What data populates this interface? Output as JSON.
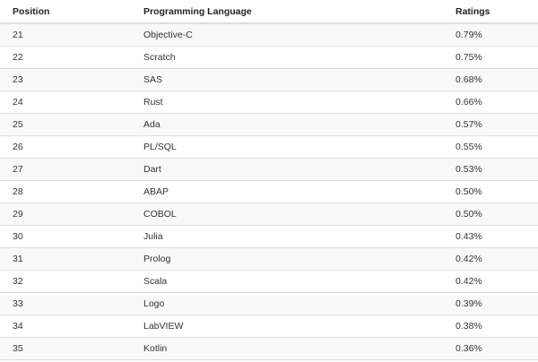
{
  "table": {
    "headers": {
      "position": "Position",
      "language": "Programming Language",
      "ratings": "Ratings"
    },
    "rows": [
      {
        "position": "21",
        "language": "Objective-C",
        "rating": "0.79%"
      },
      {
        "position": "22",
        "language": "Scratch",
        "rating": "0.75%"
      },
      {
        "position": "23",
        "language": "SAS",
        "rating": "0.68%"
      },
      {
        "position": "24",
        "language": "Rust",
        "rating": "0.66%"
      },
      {
        "position": "25",
        "language": "Ada",
        "rating": "0.57%"
      },
      {
        "position": "26",
        "language": "PL/SQL",
        "rating": "0.55%"
      },
      {
        "position": "27",
        "language": "Dart",
        "rating": "0.53%"
      },
      {
        "position": "28",
        "language": "ABAP",
        "rating": "0.50%"
      },
      {
        "position": "29",
        "language": "COBOL",
        "rating": "0.50%"
      },
      {
        "position": "30",
        "language": "Julia",
        "rating": "0.43%"
      },
      {
        "position": "31",
        "language": "Prolog",
        "rating": "0.42%"
      },
      {
        "position": "32",
        "language": "Scala",
        "rating": "0.42%"
      },
      {
        "position": "33",
        "language": "Logo",
        "rating": "0.39%"
      },
      {
        "position": "34",
        "language": "LabVIEW",
        "rating": "0.38%"
      },
      {
        "position": "35",
        "language": "Kotlin",
        "rating": "0.36%"
      }
    ]
  }
}
